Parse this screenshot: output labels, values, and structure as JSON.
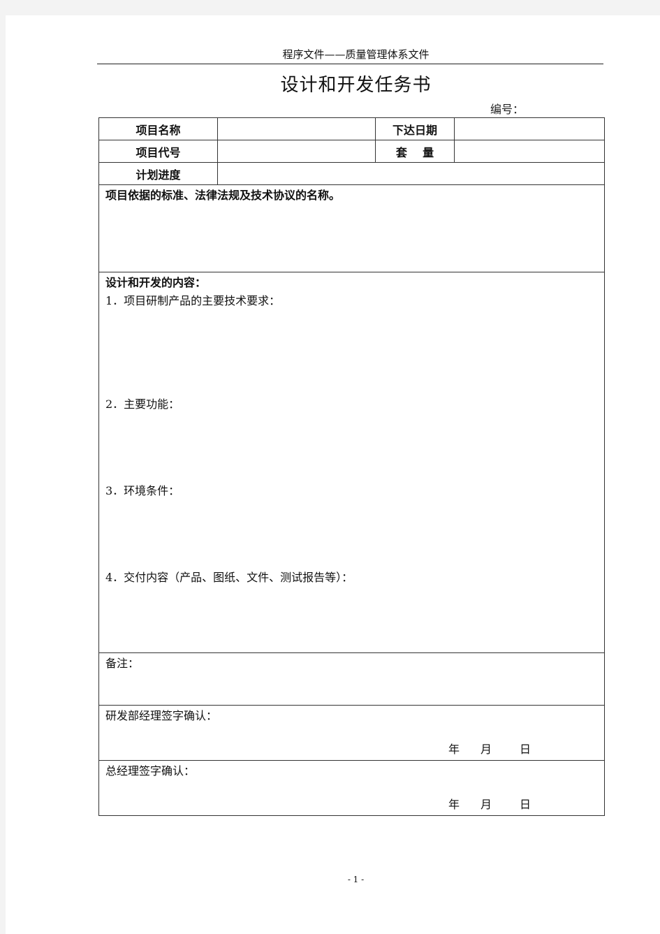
{
  "header": {
    "running_header": "程序文件——质量管理体系文件",
    "title": "设计和开发任务书",
    "doc_number_label": "编号："
  },
  "form": {
    "project_name_label": "项目名称",
    "project_name_value": "",
    "issue_date_label": "下达日期",
    "issue_date_value": "",
    "project_code_label": "项目代号",
    "project_code_value": "",
    "quantity_label": "套    量",
    "quantity_value": "",
    "schedule_label": "计划进度",
    "schedule_value": "",
    "standards_label": "项目依据的标准、法律法规及技术协议的名称。",
    "content_heading": "设计和开发的内容：",
    "content_items": [
      "1．项目研制产品的主要技术要求：",
      "2．主要功能：",
      "3．环境条件：",
      "4．交付内容（产品、图纸、文件、测试报告等）："
    ],
    "remarks_label": "备注：",
    "rd_manager_sign_label": "研发部经理签字确认：",
    "gm_sign_label": "总经理签字确认：",
    "date_parts": [
      "年",
      "月",
      "日"
    ]
  },
  "footer": {
    "page_number": "- 1 -"
  }
}
